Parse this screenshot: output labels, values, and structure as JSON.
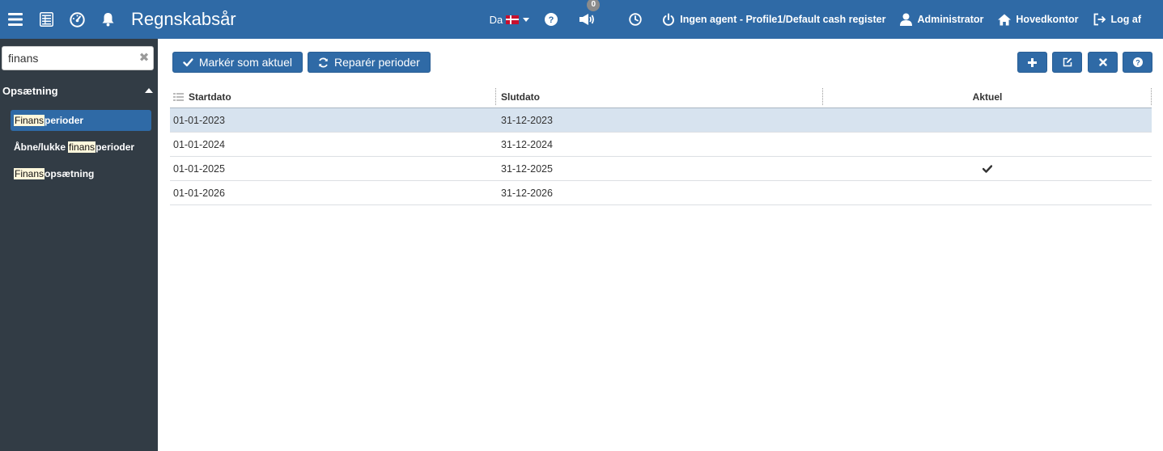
{
  "header": {
    "title": "Regnskabsår",
    "language": "Da",
    "notification_count": "0",
    "agent_status": "Ingen agent - Profile1/Default cash register",
    "user": "Administrator",
    "location": "Hovedkontor",
    "logout": "Log af",
    "icons": [
      "menu-icon",
      "table-icon",
      "dashboard-icon",
      "bell-icon",
      "help-icon",
      "megaphone-icon",
      "clock-icon",
      "power-icon",
      "user-icon",
      "home-icon",
      "logout-icon"
    ]
  },
  "sidebar": {
    "search": {
      "value": "finans"
    },
    "section": "Opsætning",
    "items": [
      {
        "prefix": "",
        "highlight": "Finans",
        "suffix": "perioder",
        "active": true
      },
      {
        "prefix": "Åbne/lukke",
        "highlight": "finans",
        "suffix": "perioder",
        "active": false
      },
      {
        "prefix": "",
        "highlight": "Finans",
        "suffix": "opsætning",
        "active": false
      }
    ]
  },
  "toolbar": {
    "mark_current_label": "Markér som aktuel",
    "repair_label": "Reparér perioder"
  },
  "grid": {
    "columns": [
      "Startdato",
      "Slutdato",
      "Aktuel"
    ],
    "rows": [
      {
        "start": "01-01-2023",
        "end": "31-12-2023",
        "current": false,
        "selected": true
      },
      {
        "start": "01-01-2024",
        "end": "31-12-2024",
        "current": false,
        "selected": false
      },
      {
        "start": "01-01-2025",
        "end": "31-12-2025",
        "current": true,
        "selected": false
      },
      {
        "start": "01-01-2026",
        "end": "31-12-2026",
        "current": false,
        "selected": false
      }
    ]
  },
  "colors": {
    "primary": "#2f6aa6",
    "sidebar": "#323c45",
    "selected_row": "#d7e3ef",
    "highlight": "#fff8dc"
  }
}
